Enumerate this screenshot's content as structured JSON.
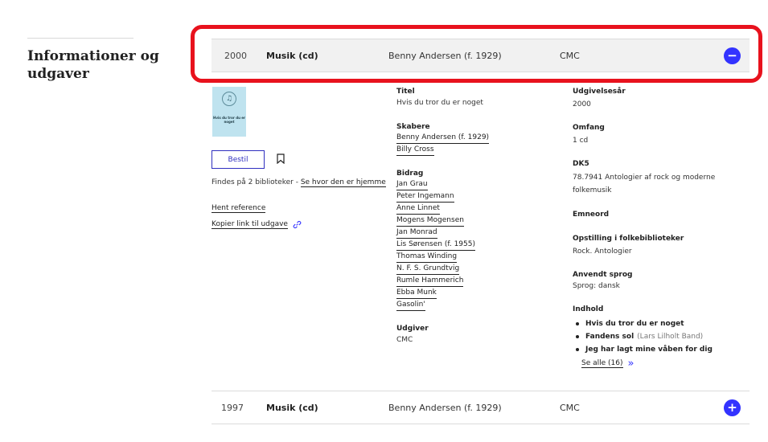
{
  "sidebar": {
    "title": "Informationer og udgaver"
  },
  "editions": [
    {
      "year": "2000",
      "material_type": "Musik (cd)",
      "creator": "Benny Andersen (f. 1929)",
      "publisher": "CMC",
      "toggle_symbol": "−",
      "expanded": true
    },
    {
      "year": "1997",
      "material_type": "Musik (cd)",
      "creator": "Benny Andersen (f. 1929)",
      "publisher": "CMC",
      "toggle_symbol": "+",
      "expanded": false
    }
  ],
  "cover": {
    "title": "Hvis du tror du er noget",
    "icon": "music-disc-icon"
  },
  "actions": {
    "order_label": "Bestil",
    "bookmark_icon": "bookmark-icon",
    "availability_text": "Findes på 2 biblioteker - ",
    "availability_link": "Se hvor den er hjemme",
    "reference_label": "Hent reference",
    "copy_link_label": "Kopier link til udgave",
    "copy_link_icon": "link-icon"
  },
  "details_left": {
    "title_label": "Titel",
    "title_value": "Hvis du tror du er noget",
    "creators_label": "Skabere",
    "creators": [
      "Benny Andersen (f. 1929)",
      "Billy Cross"
    ],
    "contributors_label": "Bidrag",
    "contributors": [
      "Jan Grau",
      "Peter Ingemann",
      "Anne Linnet",
      "Mogens Mogensen",
      "Jan Monrad",
      "Lis Sørensen (f. 1955)",
      "Thomas Winding",
      "N. F. S. Grundtvig",
      "Rumle Hammerich",
      "Ebba Munk",
      "Gasolin'"
    ],
    "publisher_label": "Udgiver",
    "publisher_value": "CMC"
  },
  "details_right": {
    "year_label": "Udgivelsesår",
    "year_value": "2000",
    "extent_label": "Omfang",
    "extent_value": "1 cd",
    "dk5_label": "DK5",
    "dk5_value": "78.7941 Antologier af rock og moderne folkemusik",
    "subjects_label": "Emneord",
    "shelving_label": "Opstilling i folkebiblioteker",
    "shelving_value": "Rock. Antologier",
    "language_label": "Anvendt sprog",
    "language_value": "Sprog: dansk",
    "contents_label": "Indhold",
    "contents": [
      {
        "title": "Hvis du tror du er noget",
        "performer": ""
      },
      {
        "title": "Fandens sol",
        "performer": "(Lars Lilholt Band)"
      },
      {
        "title": "Jeg har lagt mine våben for dig",
        "performer": ""
      }
    ],
    "see_all_label": "Se alle (16)"
  },
  "colors": {
    "accent": "#3333ff",
    "highlight": "#e8121d",
    "row_bg": "#f1f1f1",
    "cover_bg": "#bfe3ef"
  }
}
